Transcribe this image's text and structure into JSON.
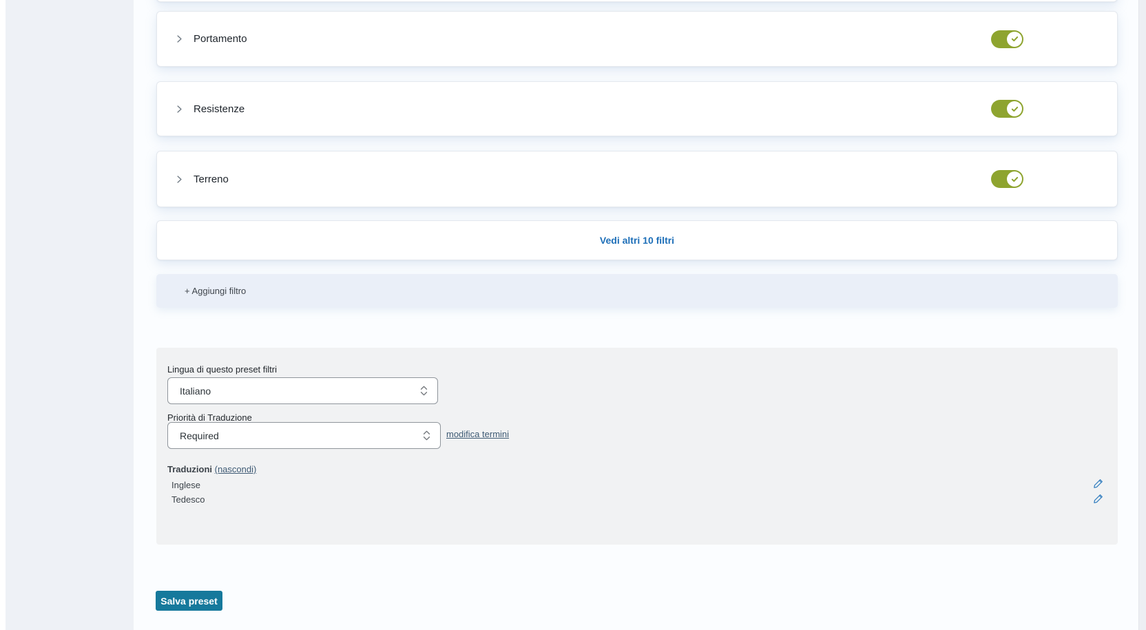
{
  "panels": [
    {
      "label": "Portamento",
      "enabled": true
    },
    {
      "label": "Resistenze",
      "enabled": true
    },
    {
      "label": "Terreno",
      "enabled": true
    }
  ],
  "show_more": {
    "label": "Vedi altri 10 filtri"
  },
  "add_filter": {
    "label": "+ Aggiungi filtro"
  },
  "settings": {
    "language_label": "Lingua di questo preset filtri",
    "language_value": "Italiano",
    "priority_label": "Priorità di Traduzione",
    "priority_value": "Required",
    "edit_terms_label": "modifica termini",
    "translations_label": "Traduzioni",
    "hide_link_label": "(nascondi)",
    "translations": [
      {
        "language": "Inglese"
      },
      {
        "language": "Tedesco"
      }
    ]
  },
  "save_button": {
    "label": "Salva preset"
  },
  "colors": {
    "toggle_on": "#8ea42f",
    "show_more_link": "#1e6fb8",
    "save_button": "#16799c",
    "pencil_icon": "#2f7cbe",
    "left_rail": "#eef1f6",
    "form_card": "#f1f2f3",
    "add_filter_card": "#eaeff8"
  }
}
